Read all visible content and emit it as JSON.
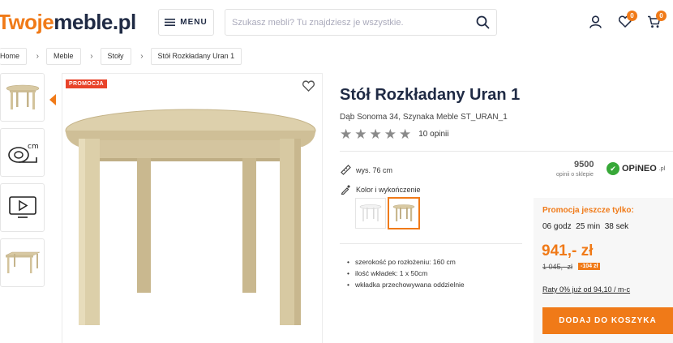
{
  "header": {
    "logo_part1": "Twoje",
    "logo_part2": "meble.pl",
    "menu_label": "MENU",
    "search_placeholder": "Szukasz mebli? Tu znajdziesz je wszystkie.",
    "wishlist_count": "0",
    "cart_count": "0"
  },
  "breadcrumb": [
    "Home",
    "Meble",
    "Stoły",
    "Stół Rozkładany Uran 1"
  ],
  "thumbnails": [
    "table-photo",
    "dimensions-icon",
    "video-icon",
    "table-extended-photo"
  ],
  "gallery": {
    "promo_badge": "PROMOCJA"
  },
  "product": {
    "title": "Stół Rozkładany Uran 1",
    "subtitle": "Dąb Sonoma 34, Szynaka Meble ST_URAN_1",
    "rating_stars": 5,
    "reviews": "10 opinii",
    "height_label": "wys. 76 cm",
    "color_label": "Kolor i wykończenie",
    "features": [
      "szerokość po rozłożeniu: 160 cm",
      "ilość wkładek: 1 x 50cm",
      "wkładka przechowywana oddzielnie"
    ]
  },
  "opineo": {
    "score": "9500",
    "caption": "opinii o sklepie",
    "brand": "OPiNEO",
    "tld": ".pl"
  },
  "promo": {
    "heading": "Promocja jeszcze tylko:",
    "countdown": "06 godz  25 min  38 sek",
    "price": "941,- zł",
    "old_price": "1 045,- zł",
    "discount": "-104 zł",
    "installments": "Raty 0% już od 94,10 / m-c",
    "cart_button": "DODAJ DO KOSZYKA"
  },
  "colors": {
    "accent": "#f07a18",
    "navy": "#1f2a44",
    "promo_red": "#e8432a",
    "wood": "#d8c9a3"
  }
}
